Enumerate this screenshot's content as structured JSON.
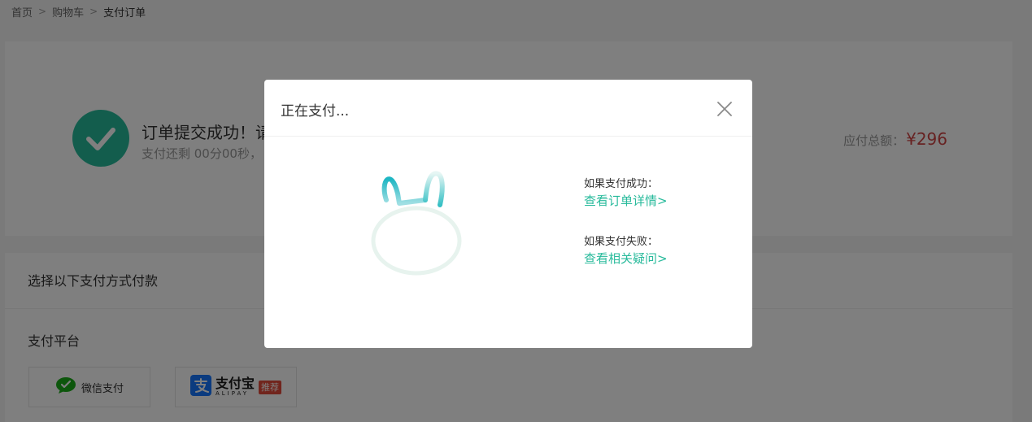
{
  "breadcrumb": {
    "items": [
      "首页",
      "购物车",
      "支付订单"
    ],
    "separator": ">"
  },
  "order": {
    "title": "订单提交成功！请",
    "countdown": "支付还剩 00分00秒，",
    "amount_label": "应付总额：",
    "amount_value": "¥296",
    "status_icon": "check-circle-icon"
  },
  "payment": {
    "section_title": "选择以下支付方式付款",
    "platform_title": "支付平台",
    "wechat_label": "微信支付",
    "alipay_label_cn": "支付宝",
    "alipay_label_en": "ALIPAY",
    "recommend_tag": "推荐"
  },
  "modal": {
    "title": "正在支付...",
    "success_hint": "如果支付成功：",
    "success_link": "查看订单详情>",
    "fail_hint": "如果支付失败：",
    "fail_link": "查看相关疑问>",
    "loading_icon": "rabbit-loading-icon",
    "close_icon": "close-icon"
  },
  "colors": {
    "accent": "#27ba9b",
    "price": "#cf4444",
    "overlay": "rgba(0,0,0,0.5)"
  }
}
